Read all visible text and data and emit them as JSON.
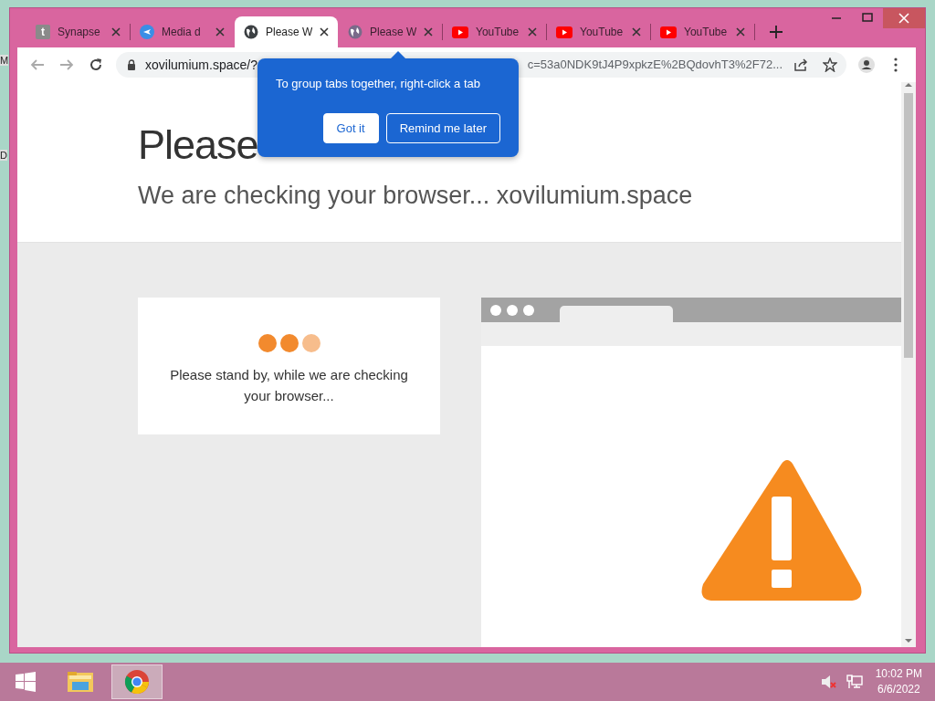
{
  "desktop": {
    "labels": [
      "M",
      "D"
    ]
  },
  "browser": {
    "tabs": [
      {
        "title": "Synapse",
        "kind": "letter",
        "icon_text": "t",
        "selected": false
      },
      {
        "title": "Media d",
        "kind": "arrow",
        "selected": false
      },
      {
        "title": "Please W",
        "kind": "globe",
        "selected": true
      },
      {
        "title": "Please W",
        "kind": "globe",
        "selected": false
      },
      {
        "title": "YouTube",
        "kind": "play",
        "selected": false
      },
      {
        "title": "YouTube",
        "kind": "play",
        "selected": false
      },
      {
        "title": "YouTube",
        "kind": "play",
        "selected": false
      }
    ],
    "address": {
      "url_start": "xovilumium.space/?",
      "url_end": "c=53a0NDK9tJ4P9xpkzE%2BQdovhT3%2F72..."
    },
    "popup": {
      "message": "To group tabs together, right-click a tab",
      "buttons": [
        {
          "label": "Got it",
          "kind": "filled"
        },
        {
          "label": "Remind me later",
          "kind": "outline"
        }
      ]
    }
  },
  "page": {
    "heading": "Please",
    "subheading": "We are checking your browser... xovilumium.space",
    "dots": [
      {
        "color": "#f28a2e"
      },
      {
        "color": "#f28a2e"
      },
      {
        "color": "#f7bd8c"
      }
    ],
    "card_message": "Please stand by, while we are checking your browser..."
  },
  "taskbar": {
    "apps": [
      {
        "kind": "start",
        "selected": false
      },
      {
        "kind": "folder",
        "selected": false
      },
      {
        "kind": "chrome",
        "selected": true
      }
    ],
    "volume_muted": true,
    "time": "10:02 PM",
    "date": "6/6/2022"
  }
}
